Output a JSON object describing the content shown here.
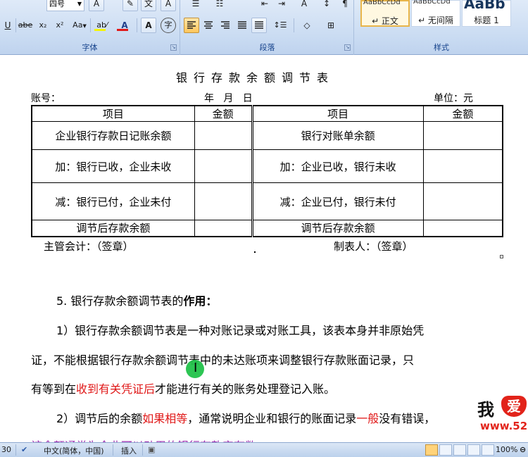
{
  "ribbon": {
    "font_group": {
      "label": "字体",
      "font_size": "四号",
      "buttons": {
        "underline": "U",
        "strikethrough": "abe",
        "subscript": "x₂",
        "superscript": "x²",
        "change_case": "Aa",
        "highlight": "ab⁄",
        "font_color": "A",
        "char_shading": "A",
        "enclose_char": "字"
      }
    },
    "paragraph_group": {
      "label": "段落"
    },
    "styles_group": {
      "label": "样式",
      "styles": [
        {
          "sample": "AaBbCcDd",
          "name": "↵ 正文"
        },
        {
          "sample": "AaBbCcDd",
          "name": "↵ 无间隔"
        },
        {
          "sample": "AaBb",
          "name": "标题 1"
        }
      ]
    },
    "colors": {
      "font_color_bar": "#e01818",
      "highlight_bar": "#f5f500"
    }
  },
  "document": {
    "title": "银行存款余额调节表",
    "account_label": "账号：",
    "date_label": "年   月   日",
    "unit_label": "单位：元",
    "table": {
      "headers": [
        "项目",
        "金额",
        "项目",
        "金额"
      ],
      "rows": [
        [
          "企业银行存款日记账余额",
          "",
          "银行对账单余额",
          ""
        ],
        [
          "加：银行已收，企业未收",
          "",
          "加：企业已收，银行未收",
          ""
        ],
        [
          "减：银行已付，企业未付",
          "",
          "减：企业已付，银行未付",
          ""
        ],
        [
          "调节后存款余额",
          "",
          "调节后存款余额",
          ""
        ]
      ]
    },
    "supervisor": "主管会计：（签章）",
    "preparer": "制表人：（签章）",
    "heading5": {
      "prefix": "5. 银行存款余额调节表的",
      "bold": "作用："
    },
    "p1_line1": "1）银行存款余额调节表是一种对账记录或对账工具，该表本身并非原始凭",
    "p1_line2": "证，不能根据银行存款余额调节表中的未达账项来调整银行存款账面记录，只",
    "p1_line3": {
      "a": "有等到在",
      "red": "收到有关凭证后",
      "b": "才能进行有关的账务处理登记入账。"
    },
    "p2_line1": {
      "a": "2）调节后的余额",
      "red1": "如果相等",
      "b": "，通常说明企业和银行的账面记录",
      "red2": "一般",
      "c": "没有错误，"
    },
    "p2_line2_partial": "该余额通常为企业可以动用的银行存款实有数。",
    "watermark": {
      "text": "我",
      "heart": "爱",
      "url": "www.52"
    }
  },
  "status_bar": {
    "page_info": "30",
    "language": "中文(简体，中国)",
    "insert_mode": "插入",
    "zoom": "100%"
  }
}
